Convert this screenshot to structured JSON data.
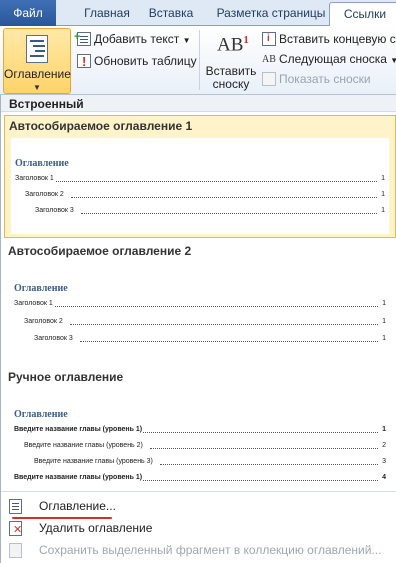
{
  "tabs": {
    "file": "Файл",
    "home": "Главная",
    "insert": "Вставка",
    "layout": "Разметка страницы",
    "references": "Ссылки"
  },
  "ribbon": {
    "toc_button": "Оглавление",
    "add_text": "Добавить текст",
    "update_table": "Обновить таблицу",
    "insert_footnote_line1": "Вставить",
    "insert_footnote_line2": "сноску",
    "footnote_icon_text": "AB",
    "footnote_icon_sup": "1",
    "insert_endnote": "Вставить концевую сно",
    "next_footnote": "Следующая сноска",
    "show_notes": "Показать сноски"
  },
  "gallery": {
    "header": "Встроенный",
    "items": [
      {
        "title": "Автособираемое оглавление 1",
        "preview_title": "Оглавление",
        "rows": [
          {
            "text": "Заголовок 1",
            "page": "1"
          },
          {
            "text": "Заголовок 2",
            "page": "1"
          },
          {
            "text": "Заголовок 3",
            "page": "1"
          }
        ]
      },
      {
        "title": "Автособираемое оглавление 2",
        "preview_title": "Оглавление",
        "rows": [
          {
            "text": "Заголовок 1",
            "page": "1"
          },
          {
            "text": "Заголовок 2",
            "page": "1"
          },
          {
            "text": "Заголовок 3",
            "page": "1"
          }
        ]
      },
      {
        "title": "Ручное оглавление",
        "preview_title": "Оглавление",
        "rows": [
          {
            "text": "Введите название главы (уровень 1)",
            "page": "1"
          },
          {
            "text": "Введите название главы (уровень 2)",
            "page": "2"
          },
          {
            "text": "Введите название главы (уровень 3)",
            "page": "3"
          },
          {
            "text": "Введите название главы (уровень 1)",
            "page": "4"
          }
        ]
      }
    ]
  },
  "menu": {
    "toc_dialog": "Оглавление...",
    "remove_toc": "Удалить оглавление",
    "save_selection": "Сохранить выделенный фрагмент в коллекцию оглавлений..."
  },
  "colors": {
    "accent_file_tab": "#2b579a",
    "selection_fill": "#fff3c9",
    "selection_border": "#e7b94b",
    "toc_title_blue": "#3b5e8c",
    "annotation_red": "#d92b2b"
  }
}
